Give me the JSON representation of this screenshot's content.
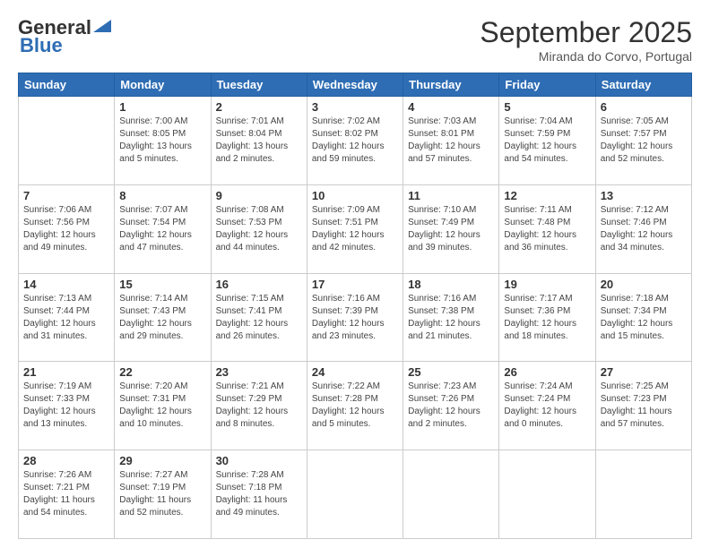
{
  "header": {
    "logo_general": "General",
    "logo_blue": "Blue",
    "month_title": "September 2025",
    "location": "Miranda do Corvo, Portugal"
  },
  "days_of_week": [
    "Sunday",
    "Monday",
    "Tuesday",
    "Wednesday",
    "Thursday",
    "Friday",
    "Saturday"
  ],
  "weeks": [
    [
      {
        "day": "",
        "info": ""
      },
      {
        "day": "1",
        "info": "Sunrise: 7:00 AM\nSunset: 8:05 PM\nDaylight: 13 hours\nand 5 minutes."
      },
      {
        "day": "2",
        "info": "Sunrise: 7:01 AM\nSunset: 8:04 PM\nDaylight: 13 hours\nand 2 minutes."
      },
      {
        "day": "3",
        "info": "Sunrise: 7:02 AM\nSunset: 8:02 PM\nDaylight: 12 hours\nand 59 minutes."
      },
      {
        "day": "4",
        "info": "Sunrise: 7:03 AM\nSunset: 8:01 PM\nDaylight: 12 hours\nand 57 minutes."
      },
      {
        "day": "5",
        "info": "Sunrise: 7:04 AM\nSunset: 7:59 PM\nDaylight: 12 hours\nand 54 minutes."
      },
      {
        "day": "6",
        "info": "Sunrise: 7:05 AM\nSunset: 7:57 PM\nDaylight: 12 hours\nand 52 minutes."
      }
    ],
    [
      {
        "day": "7",
        "info": "Sunrise: 7:06 AM\nSunset: 7:56 PM\nDaylight: 12 hours\nand 49 minutes."
      },
      {
        "day": "8",
        "info": "Sunrise: 7:07 AM\nSunset: 7:54 PM\nDaylight: 12 hours\nand 47 minutes."
      },
      {
        "day": "9",
        "info": "Sunrise: 7:08 AM\nSunset: 7:53 PM\nDaylight: 12 hours\nand 44 minutes."
      },
      {
        "day": "10",
        "info": "Sunrise: 7:09 AM\nSunset: 7:51 PM\nDaylight: 12 hours\nand 42 minutes."
      },
      {
        "day": "11",
        "info": "Sunrise: 7:10 AM\nSunset: 7:49 PM\nDaylight: 12 hours\nand 39 minutes."
      },
      {
        "day": "12",
        "info": "Sunrise: 7:11 AM\nSunset: 7:48 PM\nDaylight: 12 hours\nand 36 minutes."
      },
      {
        "day": "13",
        "info": "Sunrise: 7:12 AM\nSunset: 7:46 PM\nDaylight: 12 hours\nand 34 minutes."
      }
    ],
    [
      {
        "day": "14",
        "info": "Sunrise: 7:13 AM\nSunset: 7:44 PM\nDaylight: 12 hours\nand 31 minutes."
      },
      {
        "day": "15",
        "info": "Sunrise: 7:14 AM\nSunset: 7:43 PM\nDaylight: 12 hours\nand 29 minutes."
      },
      {
        "day": "16",
        "info": "Sunrise: 7:15 AM\nSunset: 7:41 PM\nDaylight: 12 hours\nand 26 minutes."
      },
      {
        "day": "17",
        "info": "Sunrise: 7:16 AM\nSunset: 7:39 PM\nDaylight: 12 hours\nand 23 minutes."
      },
      {
        "day": "18",
        "info": "Sunrise: 7:16 AM\nSunset: 7:38 PM\nDaylight: 12 hours\nand 21 minutes."
      },
      {
        "day": "19",
        "info": "Sunrise: 7:17 AM\nSunset: 7:36 PM\nDaylight: 12 hours\nand 18 minutes."
      },
      {
        "day": "20",
        "info": "Sunrise: 7:18 AM\nSunset: 7:34 PM\nDaylight: 12 hours\nand 15 minutes."
      }
    ],
    [
      {
        "day": "21",
        "info": "Sunrise: 7:19 AM\nSunset: 7:33 PM\nDaylight: 12 hours\nand 13 minutes."
      },
      {
        "day": "22",
        "info": "Sunrise: 7:20 AM\nSunset: 7:31 PM\nDaylight: 12 hours\nand 10 minutes."
      },
      {
        "day": "23",
        "info": "Sunrise: 7:21 AM\nSunset: 7:29 PM\nDaylight: 12 hours\nand 8 minutes."
      },
      {
        "day": "24",
        "info": "Sunrise: 7:22 AM\nSunset: 7:28 PM\nDaylight: 12 hours\nand 5 minutes."
      },
      {
        "day": "25",
        "info": "Sunrise: 7:23 AM\nSunset: 7:26 PM\nDaylight: 12 hours\nand 2 minutes."
      },
      {
        "day": "26",
        "info": "Sunrise: 7:24 AM\nSunset: 7:24 PM\nDaylight: 12 hours\nand 0 minutes."
      },
      {
        "day": "27",
        "info": "Sunrise: 7:25 AM\nSunset: 7:23 PM\nDaylight: 11 hours\nand 57 minutes."
      }
    ],
    [
      {
        "day": "28",
        "info": "Sunrise: 7:26 AM\nSunset: 7:21 PM\nDaylight: 11 hours\nand 54 minutes."
      },
      {
        "day": "29",
        "info": "Sunrise: 7:27 AM\nSunset: 7:19 PM\nDaylight: 11 hours\nand 52 minutes."
      },
      {
        "day": "30",
        "info": "Sunrise: 7:28 AM\nSunset: 7:18 PM\nDaylight: 11 hours\nand 49 minutes."
      },
      {
        "day": "",
        "info": ""
      },
      {
        "day": "",
        "info": ""
      },
      {
        "day": "",
        "info": ""
      },
      {
        "day": "",
        "info": ""
      }
    ]
  ]
}
